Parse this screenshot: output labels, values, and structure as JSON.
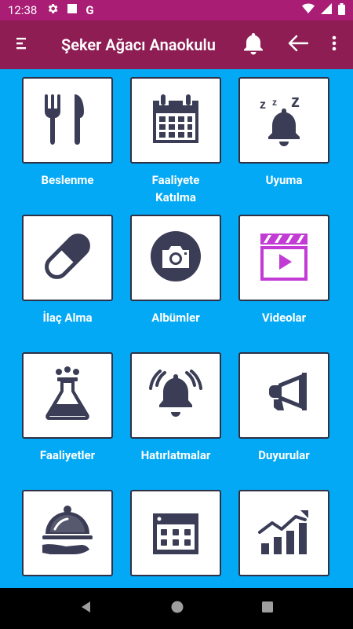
{
  "status_bar": {
    "time": "12:38",
    "icons": [
      "gear-icon",
      "square-icon",
      "google-g-icon",
      "wifi-icon",
      "signal-icon",
      "battery-icon"
    ],
    "g_letter": "G"
  },
  "app_bar": {
    "title": "Şeker Ağacı Anaokulu",
    "icons": [
      "menu-icon",
      "bell-icon",
      "back-arrow-icon",
      "more-vertical-icon"
    ]
  },
  "menu": [
    {
      "label": "Beslenme",
      "icon": "fork-knife-icon"
    },
    {
      "label": "Faaliyete Katılma",
      "icon": "calendar-icon"
    },
    {
      "label": "Uyuma",
      "icon": "sleeping-bell-icon"
    },
    {
      "label": "İlaç Alma",
      "icon": "pill-icon"
    },
    {
      "label": "Albümler",
      "icon": "camera-icon"
    },
    {
      "label": "Videolar",
      "icon": "video-clapper-icon"
    },
    {
      "label": "Faaliyetler",
      "icon": "flask-icon"
    },
    {
      "label": "Hatırlatmalar",
      "icon": "ringing-bell-icon"
    },
    {
      "label": "Duyurular",
      "icon": "megaphone-icon"
    },
    {
      "label": "",
      "icon": "serving-dish-icon"
    },
    {
      "label": "",
      "icon": "calendar-grid-icon"
    },
    {
      "label": "",
      "icon": "growth-chart-icon"
    }
  ],
  "nav_bar": {
    "icons": [
      "nav-back-icon",
      "nav-home-icon",
      "nav-recents-icon"
    ]
  },
  "colors": {
    "status_bar": "#A91E74",
    "app_bar": "#8E1D54",
    "background": "#03A9F4",
    "icon_dark": "#3A3D55",
    "video_accent": "#C23BD4"
  }
}
